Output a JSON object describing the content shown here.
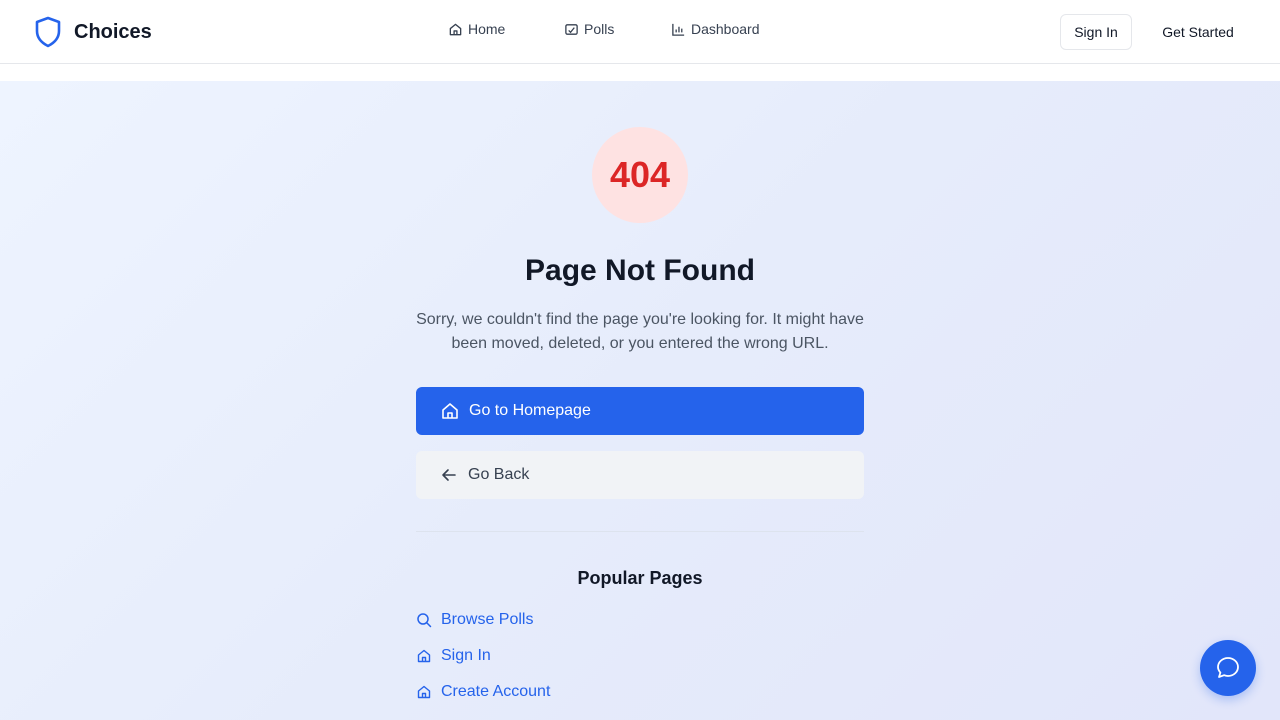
{
  "header": {
    "brand": "Choices",
    "nav": [
      {
        "label": "Home",
        "icon": "home-icon"
      },
      {
        "label": "Polls",
        "icon": "poll-icon"
      },
      {
        "label": "Dashboard",
        "icon": "bar-chart-icon"
      }
    ],
    "sign_in": "Sign In",
    "get_started": "Get Started"
  },
  "main": {
    "code": "404",
    "title": "Page Not Found",
    "description": "Sorry, we couldn't find the page you're looking for. It might have been moved, deleted, or you entered the wrong URL.",
    "primary_button": "Go to Homepage",
    "secondary_button": "Go Back",
    "popular_title": "Popular Pages",
    "popular_links": [
      {
        "label": "Browse Polls",
        "icon": "search-icon"
      },
      {
        "label": "Sign In",
        "icon": "home-icon"
      },
      {
        "label": "Create Account",
        "icon": "home-icon"
      }
    ]
  },
  "chat": {
    "icon": "chat-bubble-icon"
  },
  "colors": {
    "accent": "#2563eb",
    "error": "#dc2626",
    "error_bg": "#fee2e2"
  }
}
